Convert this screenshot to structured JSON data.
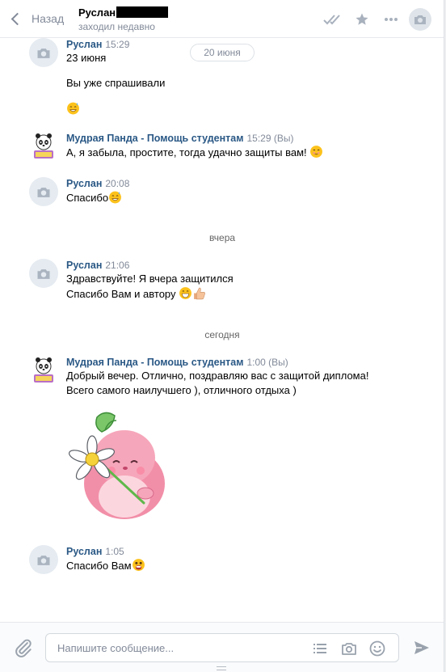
{
  "header": {
    "back_label": "Назад",
    "peer_name": "Руслан",
    "peer_status": "заходил недавно"
  },
  "composer": {
    "placeholder": "Напишите сообщение..."
  },
  "feed": {
    "date_pill": "20 июня",
    "separator_yesterday": "вчера",
    "separator_today": "сегодня",
    "messages": [
      {
        "author": "Руслан",
        "time": "15:29",
        "lines": [
          "23 июня",
          "Вы уже спрашивали"
        ]
      },
      {
        "author": "Мудрая Панда - Помощь студентам",
        "time": "15:29 (Вы)",
        "lines": [
          "А, я забыла, простите, тогда удачно защиты вам!"
        ]
      },
      {
        "author": "Руслан",
        "time": "20:08",
        "lines": [
          "Спасибо"
        ]
      },
      {
        "author": "Руслан",
        "time": "21:06",
        "lines": [
          "Здравствуйте! Я вчера защитился",
          "Спасибо Вам и автору"
        ]
      },
      {
        "author": "Мудрая Панда - Помощь студентам",
        "time": "1:00 (Вы)",
        "lines": [
          "Добрый вечер. Отлично, поздравляю вас с защитой диплома!",
          "Всего самого наилучшего ), отличного отдыха )"
        ]
      },
      {
        "author": "Руслан",
        "time": "1:05",
        "lines": [
          "Спасибо Вам"
        ]
      }
    ]
  },
  "colors": {
    "link": "#2a5885",
    "muted": "#828a99",
    "sticker_pink": "#f28fa8"
  }
}
